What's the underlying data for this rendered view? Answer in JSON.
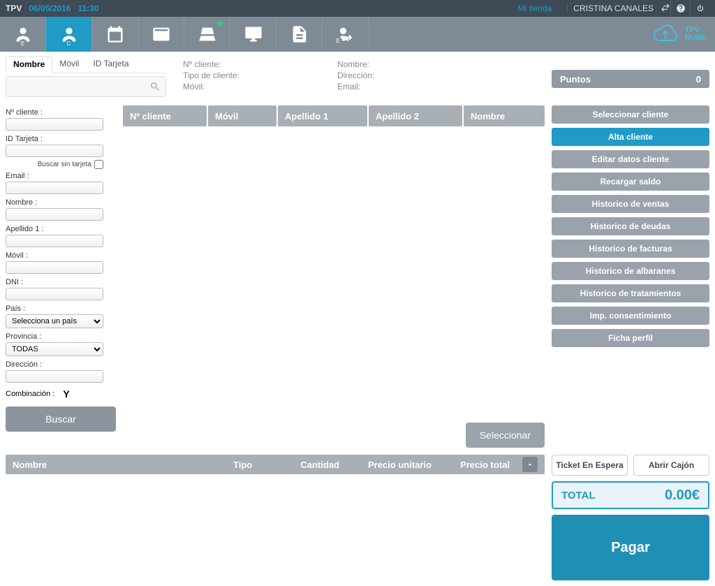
{
  "topbar": {
    "app": "TPV",
    "date": "06/05/2016",
    "time": "11:30",
    "store": "Mi tienda",
    "user": "CRISTINA CANALES"
  },
  "tabs": {
    "nombre": "Nombre",
    "movil": "Móvil",
    "idtarjeta": "ID Tarjeta"
  },
  "info": {
    "ncliente": "Nº cliente:",
    "tipocliente": "Tipo de cliente:",
    "movil": "Móvil:",
    "nombre": "Nombre:",
    "direccion": "Dirección:",
    "email": "Email:"
  },
  "points": {
    "label": "Puntos",
    "value": "0"
  },
  "filters": {
    "ncliente": "Nº cliente :",
    "idtarjeta": "ID Tarjeta :",
    "buscar_sin_tarjeta": "Buscar sin tarjeta",
    "email": "Email :",
    "nombre": "Nombre :",
    "apellido1": "Apellido 1 :",
    "movil": "Móvil :",
    "dni": "DNI :",
    "pais": "País :",
    "pais_value": "Selecciona un país",
    "provincia": "Provincia :",
    "provincia_value": "TODAS",
    "direccion": "Dirección :",
    "combinacion": "Combinación :",
    "combinacion_value": "Y",
    "buscar_btn": "Buscar"
  },
  "grid": {
    "c1": "Nº cliente",
    "c2": "Móvil",
    "c3": "Apellido 1",
    "c4": "Apellido 2",
    "c5": "Nombre"
  },
  "select_btn": "Seleccionar",
  "actions": {
    "sel": "Seleccionar cliente",
    "alta": "Alta cliente",
    "editar": "Editar datos cliente",
    "recargar": "Recargar saldo",
    "hventas": "Historico de ventas",
    "hdeudas": "Historico de deudas",
    "hfacturas": "Historico de facturas",
    "halbaranes": "Historico de albaranes",
    "htrat": "Historico de tratamientos",
    "imp": "Imp. consentimiento",
    "ficha": "Ficha perfil"
  },
  "order": {
    "nombre": "Nombre",
    "tipo": "Tipo",
    "cantidad": "Cantidad",
    "pu": "Precio unitario",
    "pt": "Precio total"
  },
  "bottom": {
    "ticket": "Ticket En Espera",
    "cajon": "Abrir Cajón",
    "total_label": "TOTAL",
    "total_value": "0.00€",
    "pagar": "Pagar"
  },
  "logo": {
    "l1": "TPV",
    "l2": "NUBE"
  }
}
